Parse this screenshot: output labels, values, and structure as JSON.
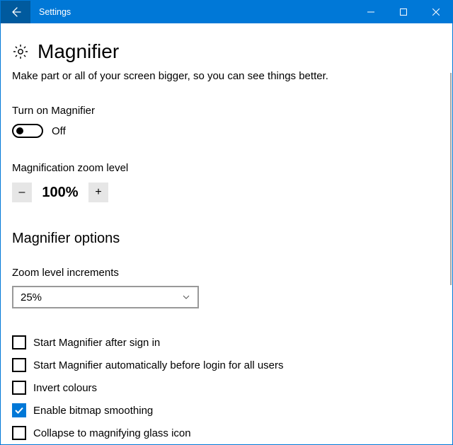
{
  "window": {
    "title": "Settings"
  },
  "page": {
    "heading": "Magnifier",
    "subtitle": "Make part or all of your screen bigger, so you can see things better."
  },
  "toggle": {
    "label": "Turn on Magnifier",
    "state_text": "Off"
  },
  "zoom": {
    "label": "Magnification zoom level",
    "minus": "–",
    "value": "100%",
    "plus": "+"
  },
  "options": {
    "heading": "Magnifier options",
    "increments_label": "Zoom level increments",
    "increments_value": "25%",
    "checkboxes": [
      {
        "label": "Start Magnifier after sign in",
        "checked": false
      },
      {
        "label": "Start Magnifier automatically before login for all users",
        "checked": false
      },
      {
        "label": "Invert colours",
        "checked": false
      },
      {
        "label": "Enable bitmap smoothing",
        "checked": true
      },
      {
        "label": "Collapse to magnifying glass icon",
        "checked": false
      }
    ]
  }
}
